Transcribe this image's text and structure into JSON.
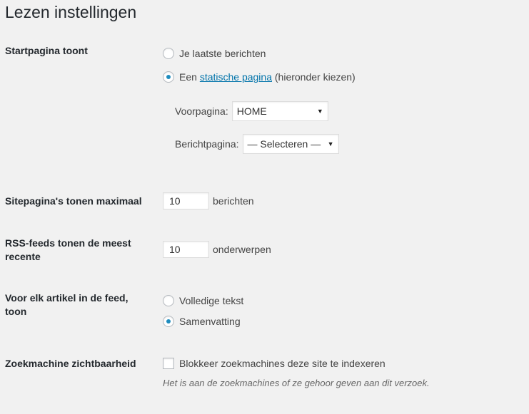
{
  "page_title": "Lezen instellingen",
  "front_page": {
    "label": "Startpagina toont",
    "options": [
      {
        "text": "Je laatste berichten",
        "checked": false
      },
      {
        "text_before": "Een ",
        "link": "statische pagina",
        "text_after": " (hieronder kiezen)",
        "checked": true
      }
    ],
    "front_label": "Voorpagina:",
    "front_value": "HOME",
    "posts_label": "Berichtpagina:",
    "posts_value": "— Selecteren —"
  },
  "posts_per_page": {
    "label": "Sitepagina's tonen maximaal",
    "value": "10",
    "suffix": "berichten"
  },
  "posts_per_rss": {
    "label": "RSS-feeds tonen de meest recente",
    "value": "10",
    "suffix": "onderwerpen"
  },
  "rss_use_excerpt": {
    "label": "Voor elk artikel in de feed, toon",
    "options": [
      {
        "text": "Volledige tekst",
        "checked": false
      },
      {
        "text": "Samenvatting",
        "checked": true
      }
    ]
  },
  "search_engine": {
    "label": "Zoekmachine zichtbaarheid",
    "checkbox_text": "Blokkeer zoekmachines deze site te indexeren",
    "checked": false,
    "description": "Het is aan de zoekmachines of ze gehoor geven aan dit verzoek."
  }
}
